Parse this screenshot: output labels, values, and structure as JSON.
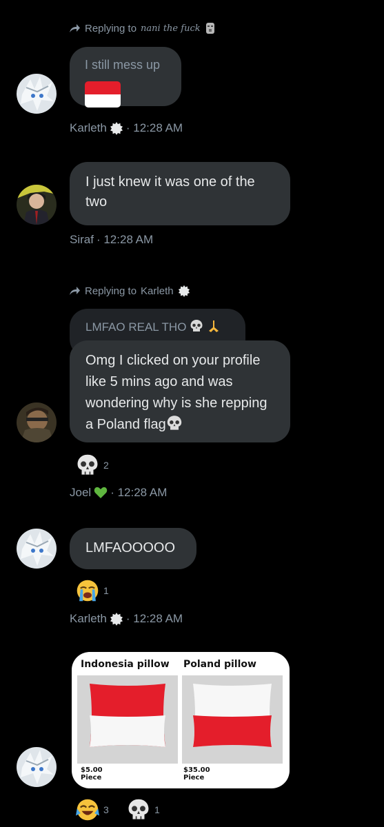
{
  "messages": {
    "m1": {
      "reply_prefix": "Replying to",
      "reply_to": "nani the fuck",
      "text": "I still mess up",
      "sender": "Karleth",
      "time": "· 12:28 AM"
    },
    "m2": {
      "text": "I just knew it was one of the two",
      "sender": "Siraf",
      "time": "· 12:28 AM"
    },
    "m3": {
      "reply_prefix": "Replying to",
      "reply_to": "Karleth",
      "quoted": "LMFAO REAL THO",
      "text": "Omg I clicked on your profile like 5 mins ago and was wondering why is she repping a Poland flag",
      "reaction_count": "2",
      "sender": "Joel",
      "time": "· 12:28 AM"
    },
    "m4": {
      "text": "LMFAOOOOO",
      "reaction_count": "1",
      "sender": "Karleth",
      "time": "· 12:28 AM"
    },
    "m5": {
      "left_title": "Indonesia pillow",
      "left_price": "$5.00",
      "left_unit": "Piece",
      "right_title": "Poland pillow",
      "right_price": "$35.00",
      "right_unit": "Piece",
      "reaction1_count": "3",
      "reaction2_count": "1"
    }
  },
  "colors": {
    "background": "#000000",
    "bubble": "#2f3336",
    "muted_text": "#8b98a5",
    "flag_red": "#e41e2b"
  }
}
